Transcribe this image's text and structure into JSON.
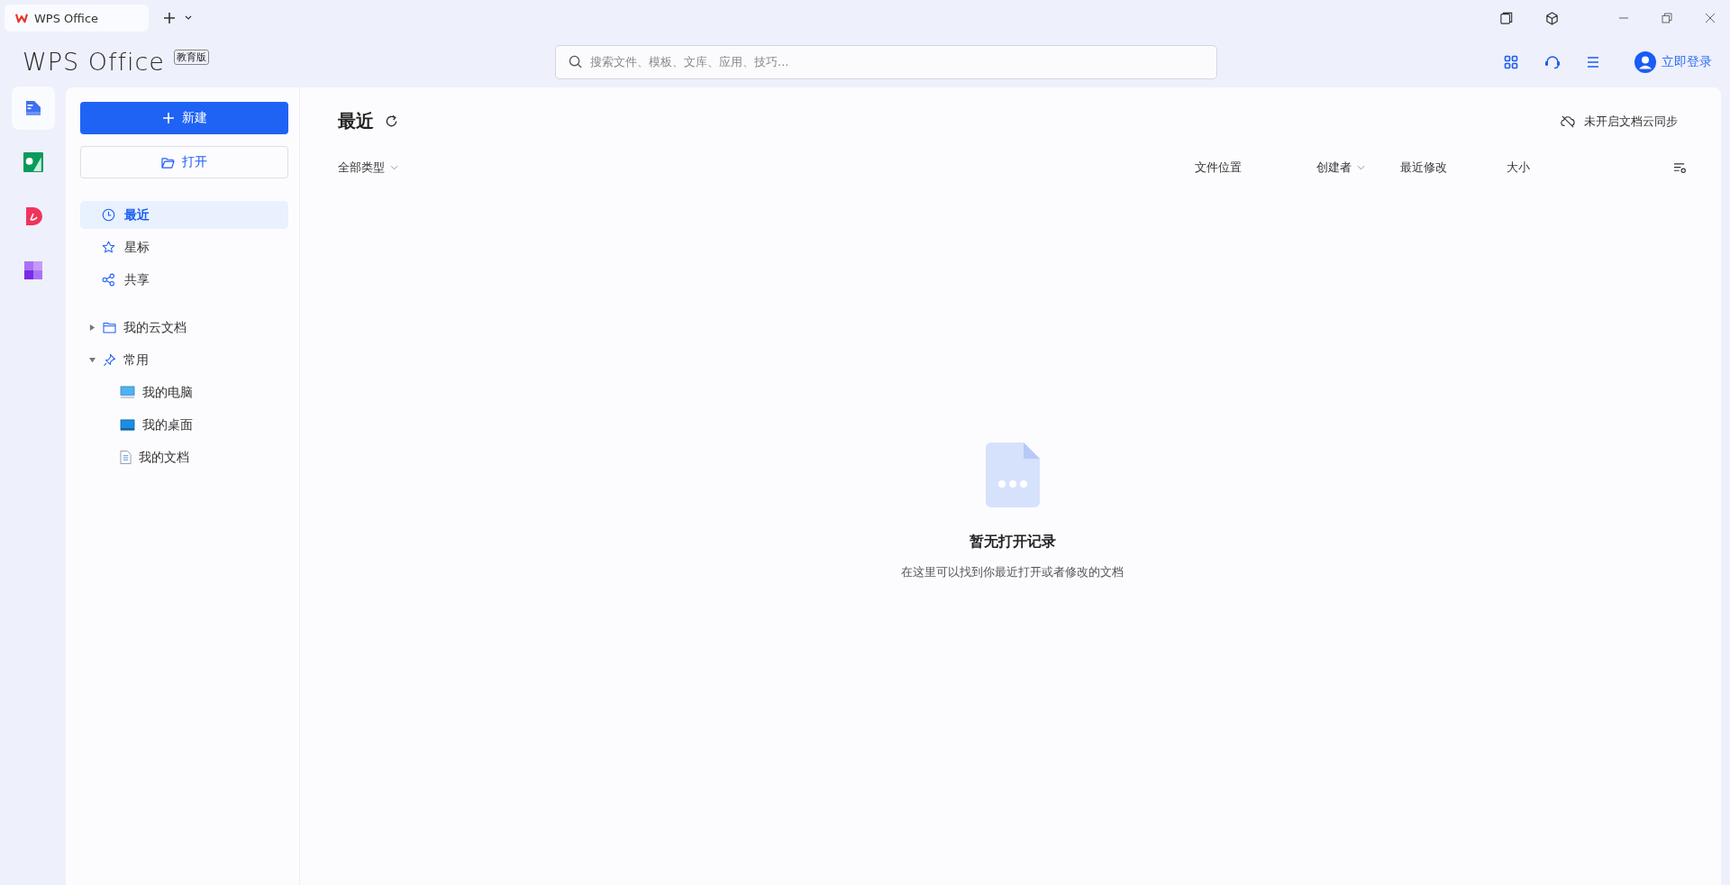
{
  "titlebar": {
    "tabs": [
      {
        "label": "WPS Office",
        "selected": true
      }
    ]
  },
  "header": {
    "logo": "WPS Office",
    "edition_badge": "教育版",
    "search": {
      "placeholder": "搜索文件、模板、文库、应用、技巧..."
    },
    "login": "立即登录"
  },
  "app_rail": [
    {
      "kind": "writer",
      "selected": true
    },
    {
      "kind": "sheet",
      "selected": false
    },
    {
      "kind": "pdf",
      "selected": false
    },
    {
      "kind": "apps",
      "selected": false
    }
  ],
  "sidebar": {
    "new_button": "新建",
    "open_button": "打开",
    "nav": [
      {
        "label": "最近",
        "kind": "clock",
        "selected": true
      },
      {
        "label": "星标",
        "kind": "star",
        "selected": false
      },
      {
        "label": "共享",
        "kind": "share",
        "selected": false
      }
    ],
    "tree": [
      {
        "label": "我的云文档",
        "kind": "folder",
        "expanded": false
      },
      {
        "label": "常用",
        "kind": "pin",
        "expanded": true,
        "children": [
          {
            "label": "我的电脑",
            "kind": "computer"
          },
          {
            "label": "我的桌面",
            "kind": "desktop"
          },
          {
            "label": "我的文档",
            "kind": "document"
          }
        ]
      }
    ]
  },
  "content": {
    "title": "最近",
    "sync_status": "未开启文档云同步",
    "type_filter": "全部类型",
    "columns": [
      {
        "label": "文件位置",
        "dropdown": false
      },
      {
        "label": "创建者",
        "dropdown": true
      },
      {
        "label": "最近修改",
        "dropdown": false
      },
      {
        "label": "大小",
        "dropdown": false
      }
    ],
    "empty": {
      "title": "暂无打开记录",
      "hint": "在这里可以找到你最近打开或者修改的文档"
    }
  }
}
